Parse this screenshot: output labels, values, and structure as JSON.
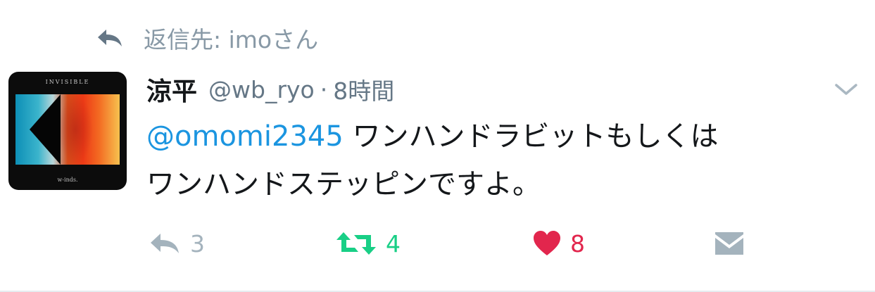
{
  "reply_context": {
    "text": "返信先: imoさん",
    "icon": "reply-arrow-icon"
  },
  "avatar": {
    "top_text": "INVISIBLE",
    "bottom_text": "w-inds."
  },
  "tweet": {
    "display_name": "涼平",
    "handle": "@wb_ryo",
    "separator": "·",
    "time": "8時間",
    "mention": "@omomi2345",
    "text_line1_rest": " ワンハンドラビットもしくは",
    "text_line2": "ワンハンドステッピンですよ。"
  },
  "actions": {
    "reply_count": "3",
    "retweet_count": "4",
    "like_count": "8",
    "retweeted": true,
    "liked": true
  },
  "colors": {
    "mention": "#1b95e0",
    "retweet_active": "#19cf86",
    "like_active": "#e2264d",
    "muted": "#8899a6"
  }
}
